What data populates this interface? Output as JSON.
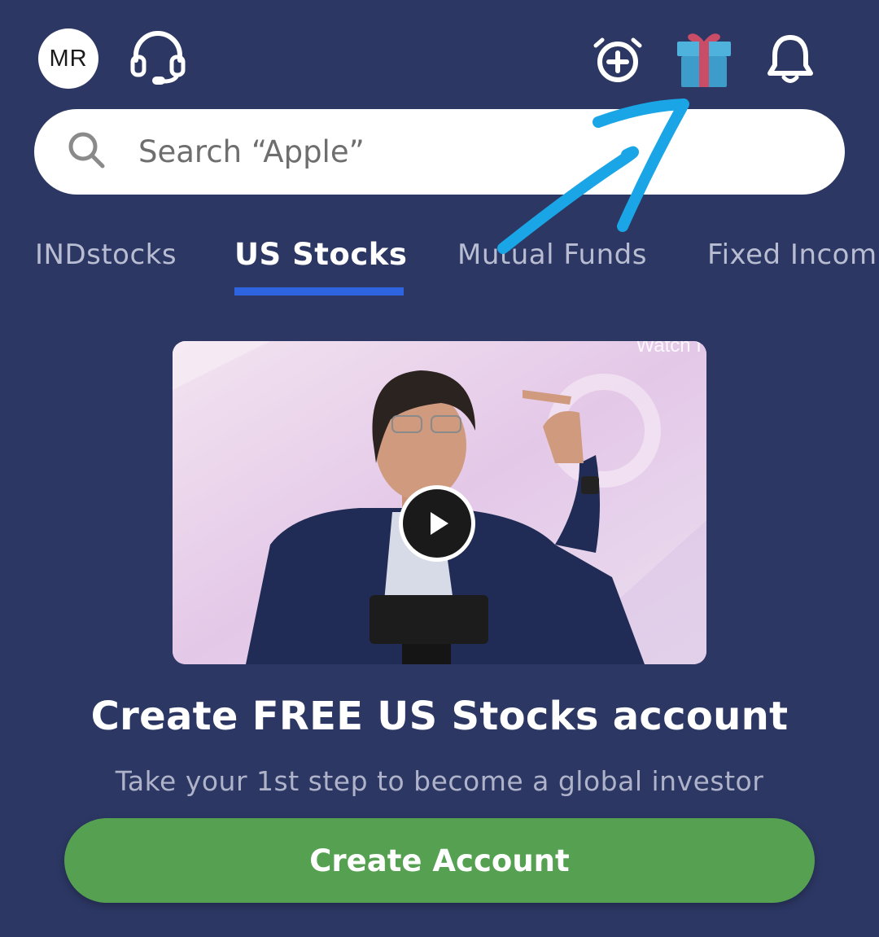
{
  "header": {
    "avatar_initials": "MR",
    "icons": [
      "headset-icon",
      "alarm-add-icon",
      "gift-icon",
      "bell-icon"
    ]
  },
  "search": {
    "placeholder": "Search “Apple”",
    "icon": "search-icon"
  },
  "tabs": [
    {
      "label": "INDstocks",
      "active": false
    },
    {
      "label": "US Stocks",
      "active": true
    },
    {
      "label": "Mutual Funds",
      "active": false
    },
    {
      "label": "Fixed Incom",
      "active": false
    }
  ],
  "video": {
    "watermark": "Watch f",
    "play_icon": "play-icon"
  },
  "promo": {
    "headline": "Create FREE US Stocks account",
    "subline": "Take your 1st step to become a global investor",
    "cta_label": "Create Account"
  },
  "colors": {
    "background": "#2c3764",
    "tab_active_underline": "#2f64e0",
    "cta_green": "#56a052",
    "annotation_arrow": "#1aa6e6"
  }
}
